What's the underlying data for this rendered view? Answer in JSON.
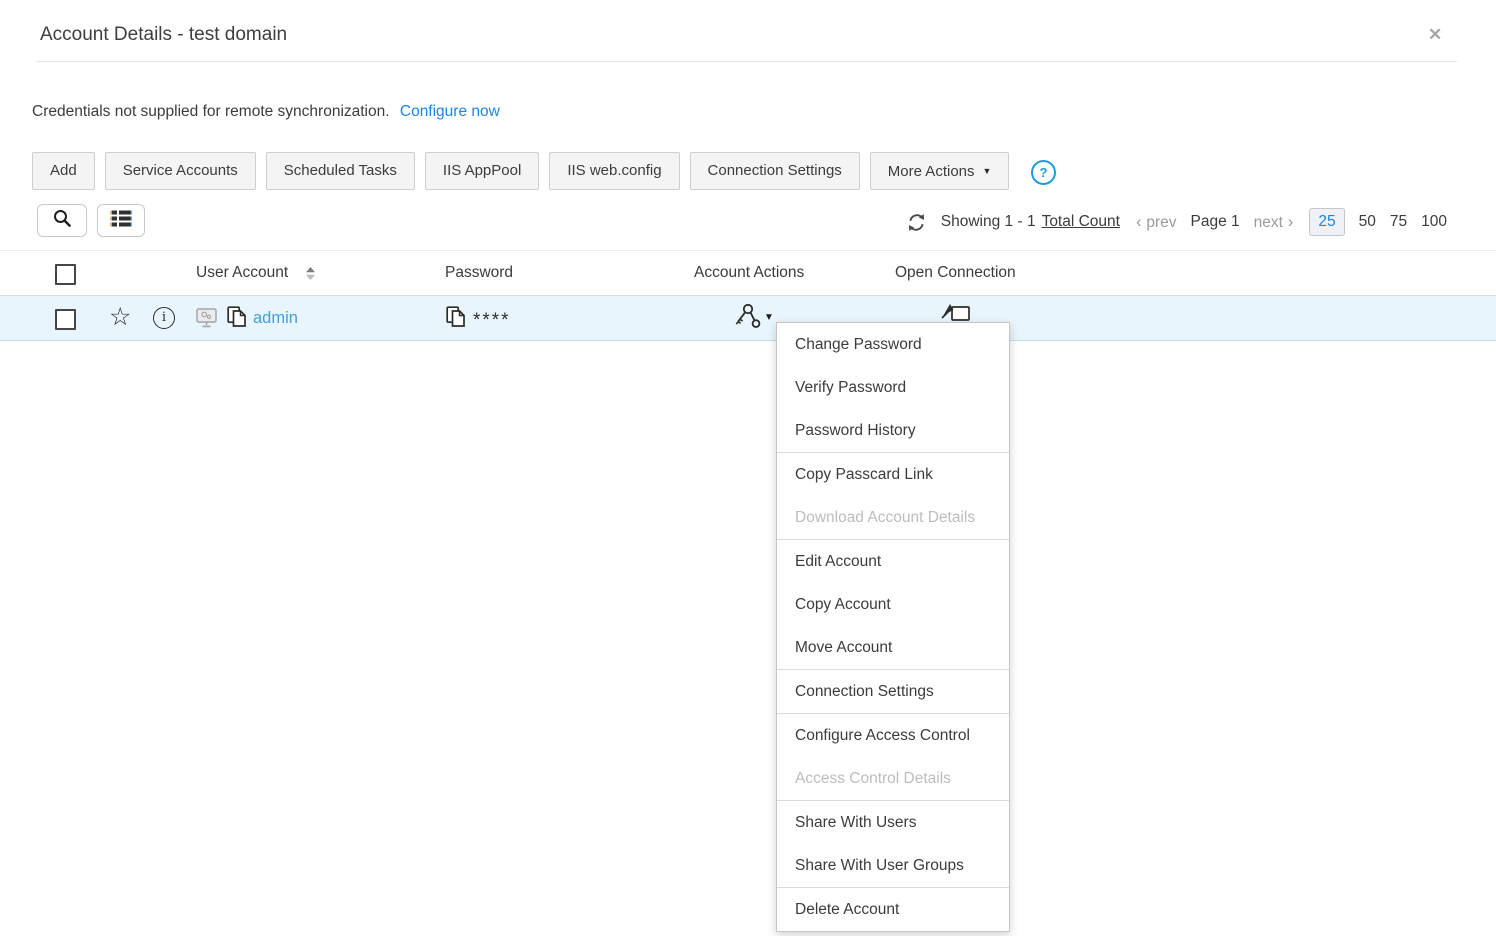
{
  "window": {
    "title": "Account Details - test domain",
    "close_glyph": "✕"
  },
  "banner": {
    "message": "Credentials not supplied for remote synchronization.",
    "link": "Configure now"
  },
  "toolbar": {
    "buttons": [
      "Add",
      "Service Accounts",
      "Scheduled Tasks",
      "IIS AppPool",
      "IIS web.config",
      "Connection Settings"
    ],
    "more_actions_label": "More Actions",
    "help_label": "?"
  },
  "pagination": {
    "showing": "Showing 1 - 1",
    "total_count_label": "Total Count",
    "prev_label": "prev",
    "page_label": "Page 1",
    "next_label": "next",
    "page_sizes": [
      "25",
      "50",
      "75",
      "100"
    ],
    "selected_page_size": "25"
  },
  "table": {
    "headers": {
      "user_account": "User Account",
      "password": "Password",
      "account_actions": "Account Actions",
      "open_connection": "Open Connection"
    },
    "rows": [
      {
        "user_account": "admin",
        "password_mask": "****"
      }
    ]
  },
  "context_menu": {
    "items": [
      {
        "label": "Change Password",
        "disabled": false
      },
      {
        "label": "Verify Password",
        "disabled": false
      },
      {
        "label": "Password History",
        "disabled": false
      },
      {
        "label": "Copy Passcard Link",
        "disabled": false
      },
      {
        "label": "Download Account Details",
        "disabled": true
      },
      {
        "label": "Edit Account",
        "disabled": false
      },
      {
        "label": "Copy Account",
        "disabled": false
      },
      {
        "label": "Move Account",
        "disabled": false
      },
      {
        "label": "Connection Settings",
        "disabled": false
      },
      {
        "label": "Configure Access Control",
        "disabled": false
      },
      {
        "label": "Access Control Details",
        "disabled": true
      },
      {
        "label": "Share With Users",
        "disabled": false
      },
      {
        "label": "Share With User Groups",
        "disabled": false
      },
      {
        "label": "Delete Account",
        "disabled": false
      }
    ]
  },
  "colors": {
    "link_blue": "#1b84e7",
    "user_link_blue": "#44a0d9",
    "row_highlight": "#e9f5fc",
    "accent_blue": "#1e9cdb"
  }
}
